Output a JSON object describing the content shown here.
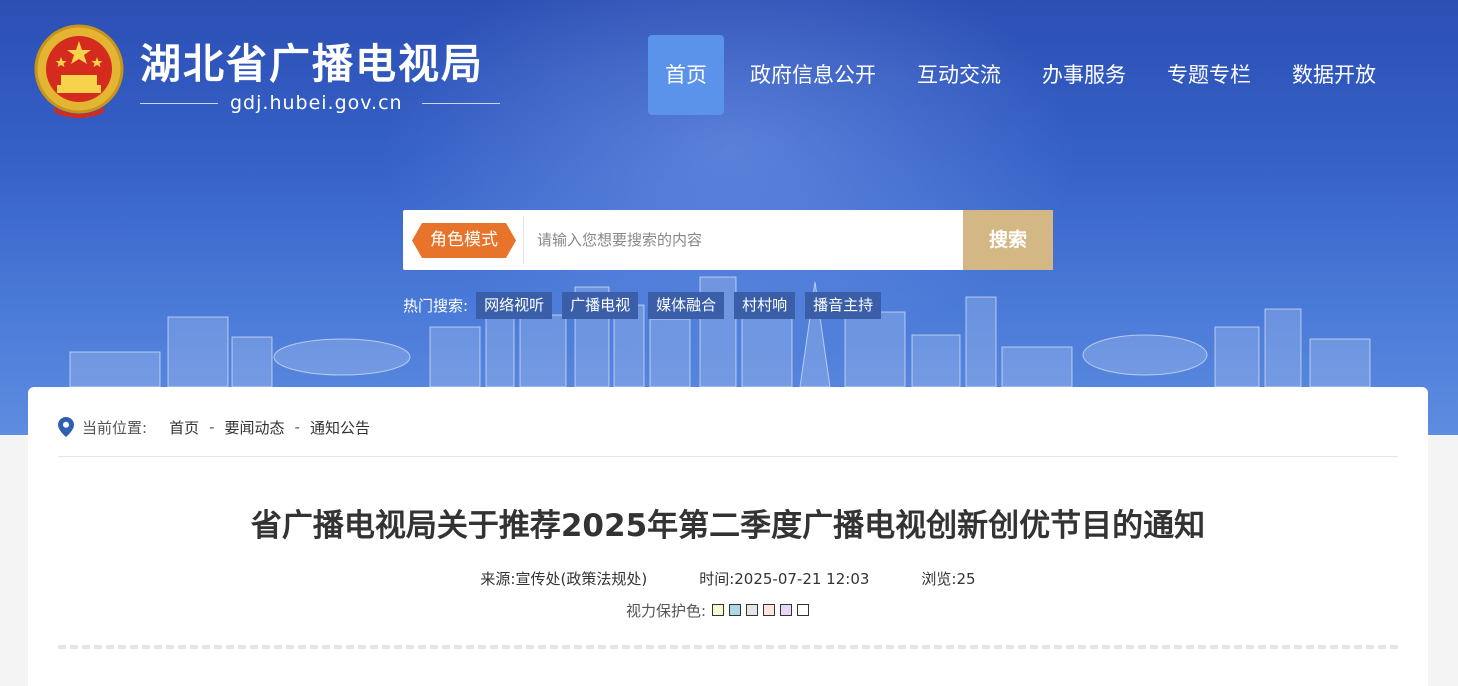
{
  "header": {
    "site_title": "湖北省广播电视局",
    "domain": "gdj.hubei.gov.cn",
    "emblem_icon": "national-emblem-icon"
  },
  "nav": {
    "items": [
      {
        "label": "首页",
        "active": true
      },
      {
        "label": "政府信息公开",
        "active": false
      },
      {
        "label": "互动交流",
        "active": false
      },
      {
        "label": "办事服务",
        "active": false
      },
      {
        "label": "专题专栏",
        "active": false
      },
      {
        "label": "数据开放",
        "active": false
      }
    ],
    "active_color": "#5b92ea"
  },
  "search": {
    "mode_label": "角色模式",
    "placeholder": "请输入您想要搜索的内容",
    "button_label": "搜索",
    "hot_label": "热门搜索:",
    "hot_tags": [
      "网络视听",
      "广播电视",
      "媒体融合",
      "村村响",
      "播音主持"
    ],
    "mode_color": "#e8742c",
    "button_color": "#d3b885"
  },
  "breadcrumb": {
    "label": "当前位置:",
    "items": [
      "首页",
      "要闻动态",
      "通知公告"
    ],
    "separator": "-",
    "icon": "location-pin-icon"
  },
  "article": {
    "title": "省广播电视局关于推荐2025年第二季度广播电视创新创优节目的通知",
    "source": "来源:宣传处(政策法规处)",
    "time": "时间:2025-07-21 12:03",
    "views": "浏览:25",
    "eye_care_label": "视力保护色:",
    "eye_care_colors": [
      "#fafad2",
      "#add8e6",
      "#e6e6e6",
      "#ffe4e1",
      "#e6d8f5",
      "#ffffff"
    ]
  }
}
